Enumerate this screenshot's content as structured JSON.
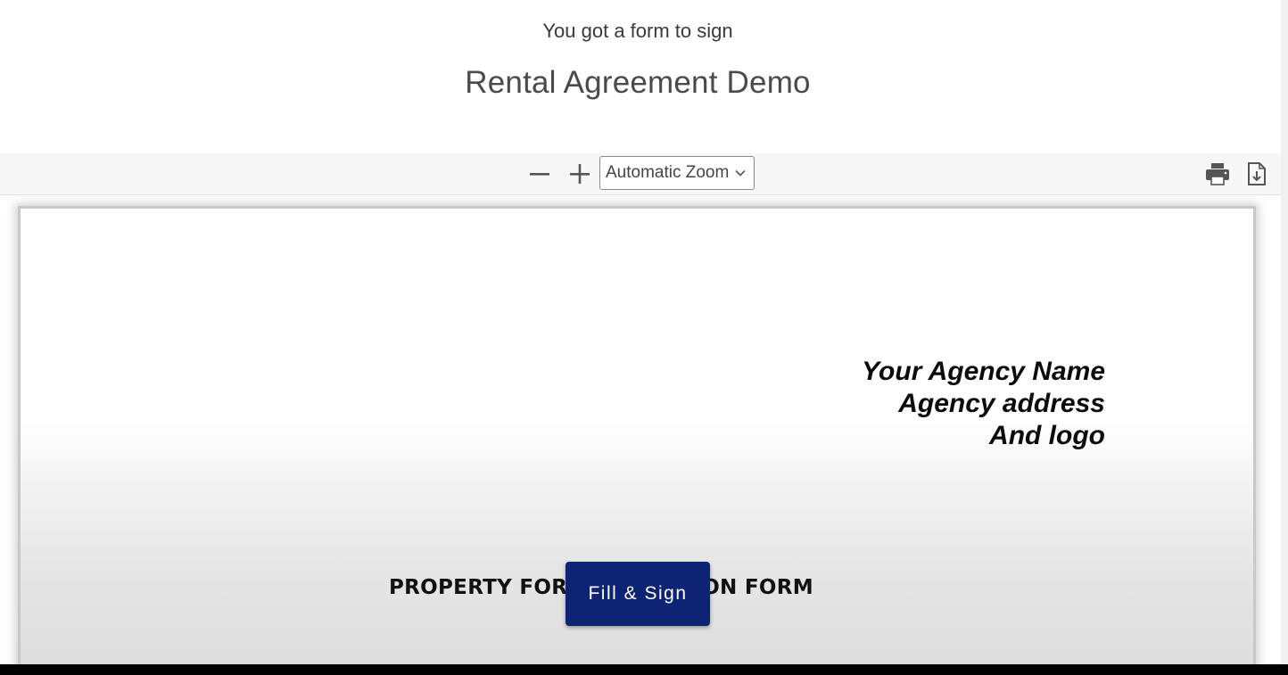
{
  "header": {
    "subtitle": "You got a form to sign",
    "title": "Rental Agreement Demo"
  },
  "toolbar": {
    "zoom_out_icon": "minus-icon",
    "zoom_in_icon": "plus-icon",
    "zoom_select_value": "Automatic Zoom",
    "print_icon": "printer-icon",
    "download_icon": "download-icon"
  },
  "document": {
    "agency_lines": [
      "Your Agency Name",
      "Agency address",
      "And logo"
    ],
    "form_title": "PROPERTY FOR RESERVATION FORM"
  },
  "actions": {
    "fill_sign_label": "Fill & Sign"
  },
  "colors": {
    "button_bg": "#0d2373",
    "toolbar_bg": "#f7f7f7"
  }
}
